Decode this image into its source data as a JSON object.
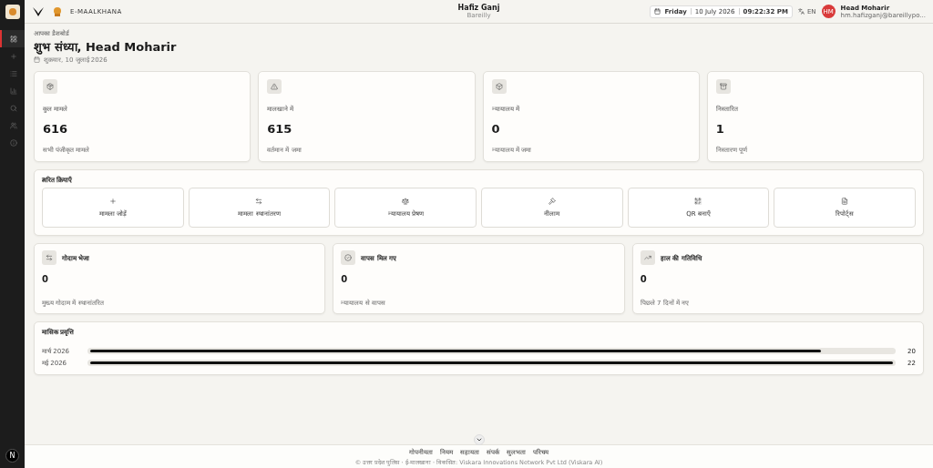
{
  "sidebar": {
    "items": [
      {
        "selected": true
      },
      {
        "selected": false
      },
      {
        "selected": false
      },
      {
        "selected": false
      },
      {
        "selected": false
      },
      {
        "selected": false
      },
      {
        "selected": false
      }
    ],
    "badge": "N"
  },
  "header": {
    "brand": "E-MAALKHANA",
    "station": "Hafiz Ganj",
    "district": "Bareilly",
    "clock": {
      "day": "Friday",
      "date": "10 July 2026",
      "time": "09:22:32 PM"
    },
    "language": "EN",
    "user": {
      "initials": "HM",
      "name": "Head Moharir",
      "email": "hm.hafizganj@bareillypo..."
    }
  },
  "greeting": {
    "eyebrow": "आपका डैशबोर्ड",
    "title": "शुभ संध्या, Head Moharir",
    "date": "शुक्रवार, 10 जुलाई 2026"
  },
  "stats": [
    {
      "label": "कुल मामले",
      "value": "616",
      "note": "सभी पंजीकृत मामले"
    },
    {
      "label": "मालखाने में",
      "value": "615",
      "note": "वर्तमान में जमा"
    },
    {
      "label": "न्यायालय में",
      "value": "0",
      "note": "न्यायालय में जमा"
    },
    {
      "label": "निस्तारित",
      "value": "1",
      "note": "निस्तारण पूर्ण"
    }
  ],
  "quick_actions": {
    "title": "त्वरित क्रियाएँ",
    "items": [
      {
        "label": "मामला जोड़ें"
      },
      {
        "label": "मामला स्थानांतरण"
      },
      {
        "label": "न्यायालय प्रेषण"
      },
      {
        "label": "नीलाम"
      },
      {
        "label": "QR बनाएँ"
      },
      {
        "label": "रिपोर्ट्स"
      }
    ]
  },
  "summary": [
    {
      "title": "गोदाम भेजा",
      "value": "0",
      "note": "मुख्य गोदाम में स्थानांतरित"
    },
    {
      "title": "वापस मिल गए",
      "value": "0",
      "note": "न्यायालय से वापस"
    },
    {
      "title": "हाल की गतिविधि",
      "value": "0",
      "note": "पिछले 7 दिनों में नए"
    }
  ],
  "monthly_trend": {
    "title": "मासिक प्रवृत्ति",
    "rows": [
      {
        "month": "मार्च 2026",
        "level": 0.91,
        "count": "20"
      },
      {
        "month": "मई 2026",
        "level": 1,
        "count": "22"
      }
    ]
  },
  "footer": {
    "links": [
      "गोपनीयता",
      "नियम",
      "सहायता",
      "संपर्क",
      "सुलभता",
      "परिचय"
    ],
    "copyright": "© उत्तर प्रदेश पुलिस · ई-मालखाना · विकसित: Viskara Innovations Network Pvt Ltd (Viskara AI)"
  }
}
